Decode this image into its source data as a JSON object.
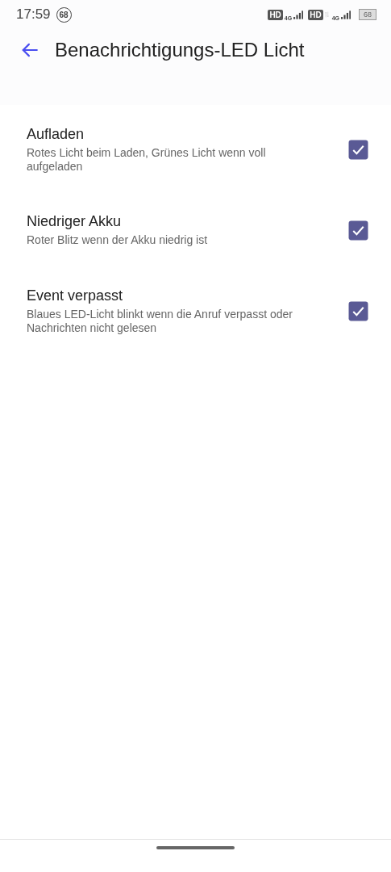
{
  "status_bar": {
    "time": "17:59",
    "notification_badge": "68",
    "sims": [
      {
        "hd": "HD",
        "network": "4G",
        "data_arrows": false
      },
      {
        "hd": "HD",
        "network": "4G",
        "data_arrows": true
      }
    ],
    "battery": "68"
  },
  "header": {
    "title": "Benachrichtigungs-LED Licht"
  },
  "settings": [
    {
      "title": "Aufladen",
      "description": "Rotes Licht beim Laden, Grünes Licht wenn voll aufgeladen",
      "checked": true
    },
    {
      "title": "Niedriger Akku",
      "description": "Roter Blitz wenn der Akku niedrig ist",
      "checked": true
    },
    {
      "title": "Event verpasst",
      "description": "Blaues LED-Licht blinkt wenn die Anruf verpasst oder Nachrichten nicht gelesen",
      "checked": true
    }
  ]
}
